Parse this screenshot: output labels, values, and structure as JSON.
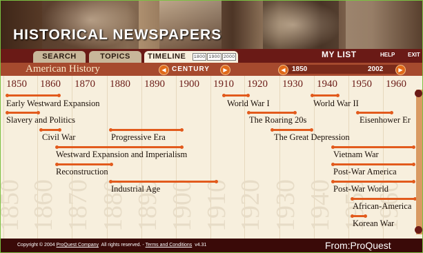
{
  "banner": {
    "title": "HISTORICAL NEWSPAPERS"
  },
  "nav": {
    "tabs": [
      {
        "label": "SEARCH"
      },
      {
        "label": "TOPICS"
      },
      {
        "label": "TIMELINE",
        "mini": [
          "1800",
          "1900",
          "2000"
        ]
      }
    ],
    "my_list": "MY LIST",
    "help": "HELP",
    "exit": "EXIT"
  },
  "controls": {
    "section_title": "American History",
    "century_label": "CENTURY",
    "range_start": "1850",
    "range_end": "2002",
    "icons": {
      "prev": "arrow-left-icon",
      "next": "arrow-right-icon"
    }
  },
  "timeline": {
    "decades": [
      "1850",
      "1860",
      "1870",
      "1880",
      "1890",
      "1900",
      "1910",
      "1920",
      "1930",
      "1940",
      "1950",
      "1960"
    ],
    "events": [
      {
        "label": "Early Westward Expansion"
      },
      {
        "label": "Slavery and Politics"
      },
      {
        "label": "Civil War"
      },
      {
        "label": "Progressive Era"
      },
      {
        "label": "Westward Expansion and Imperialism"
      },
      {
        "label": "Reconstruction"
      },
      {
        "label": "Industrial Age"
      },
      {
        "label": "World War I"
      },
      {
        "label": "The Roaring 20s"
      },
      {
        "label": "The Great Depression"
      },
      {
        "label": "World War II"
      },
      {
        "label": "Eisenhower Er"
      },
      {
        "label": "Vietnam War"
      },
      {
        "label": "Post-War America"
      },
      {
        "label": "Post-War World"
      },
      {
        "label": "African-America"
      },
      {
        "label": "Korean War"
      }
    ]
  },
  "footer": {
    "copyright_pre": "Copyright © 2004",
    "company": "ProQuest Company",
    "rights": "All rights reserved. -",
    "terms": "Terms and Conditions",
    "version": "v4.31",
    "from_logo": "From:ProQuest"
  },
  "colors": {
    "accent": "#e25a1c",
    "nav": "#6a1a16",
    "bar": "#a64a2e"
  }
}
